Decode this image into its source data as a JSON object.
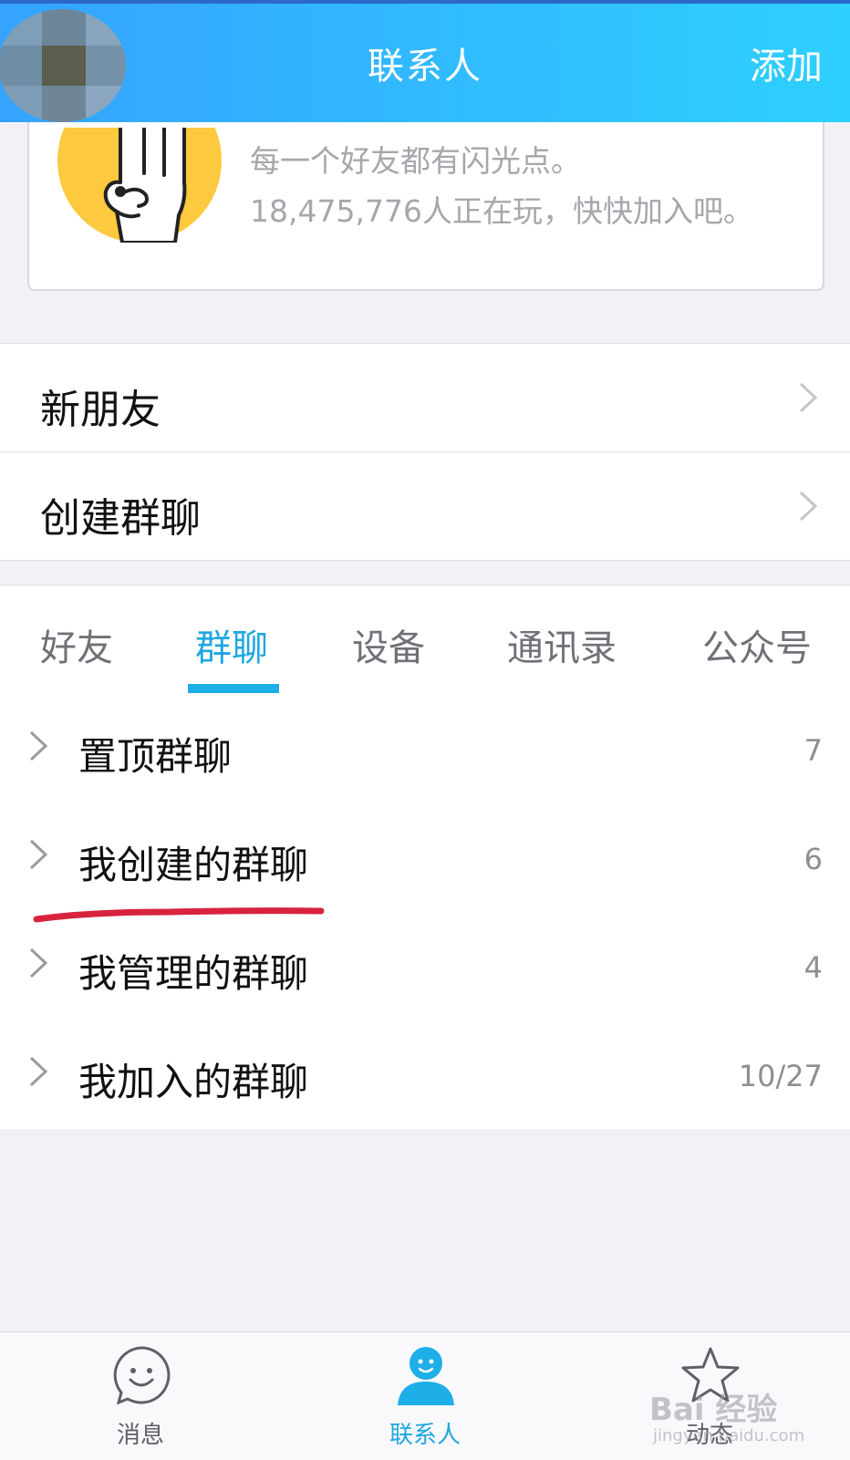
{
  "header": {
    "title": "联系人",
    "add_label": "添加",
    "gradient_start": "#35a3ff",
    "gradient_end": "#2ed0ff"
  },
  "promo": {
    "line1": "每一个好友都有闪光点。",
    "line2": "18,475,776人正在玩，快快加入吧。"
  },
  "menu": {
    "items": [
      {
        "label": "新朋友",
        "icon": "chevron-right-icon"
      },
      {
        "label": "创建群聊",
        "icon": "chevron-right-icon"
      }
    ]
  },
  "tabs": {
    "items": [
      {
        "label": "好友",
        "active": false
      },
      {
        "label": "群聊",
        "active": true
      },
      {
        "label": "设备",
        "active": false
      },
      {
        "label": "通讯录",
        "active": false
      },
      {
        "label": "公众号",
        "active": false
      }
    ],
    "active_color": "#20a6e0"
  },
  "groups": {
    "items": [
      {
        "label": "置顶群聊",
        "count": "7"
      },
      {
        "label": "我创建的群聊",
        "count": "6"
      },
      {
        "label": "我管理的群聊",
        "count": "4"
      },
      {
        "label": "我加入的群聊",
        "count": "10/27"
      }
    ],
    "annotation_color": "#d8233e"
  },
  "nav": {
    "items": [
      {
        "label": "消息",
        "icon": "smiley-chat-icon",
        "active": false
      },
      {
        "label": "联系人",
        "icon": "contact-person-icon",
        "active": true
      },
      {
        "label": "动态",
        "icon": "star-icon",
        "active": false
      }
    ]
  },
  "watermark": {
    "brand": "Bai 经验",
    "url": "jingyan.baidu.com"
  }
}
